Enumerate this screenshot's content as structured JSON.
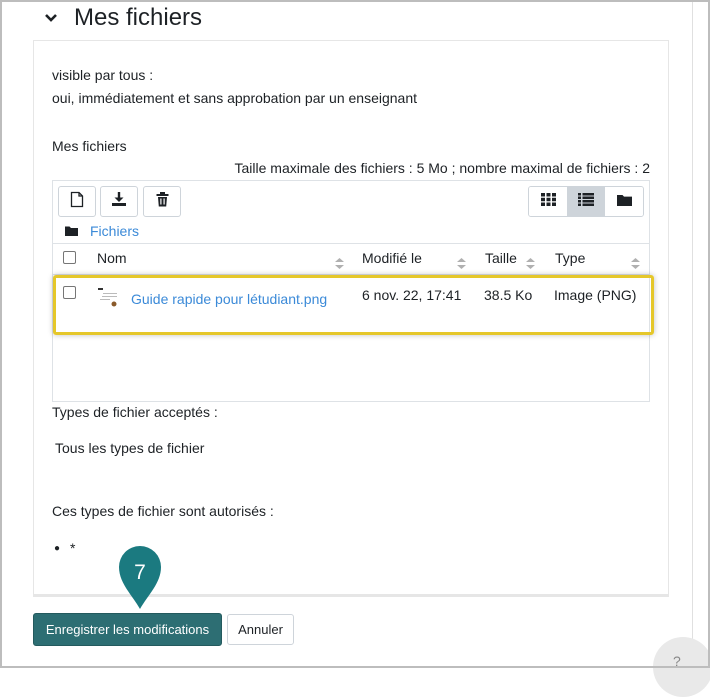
{
  "section": {
    "title": "Mes fichiers",
    "collapse_icon": "chevron-down-icon"
  },
  "visibility": {
    "label": "visible par tous :",
    "value": "oui, immédiatement et sans approbation par un enseignant"
  },
  "filepicker": {
    "label": "Mes fichiers",
    "limits": "Taille maximale des fichiers : 5 Mo ; nombre maximal de fichiers : 2",
    "toolbar": [
      "add-file-icon",
      "download-icon",
      "trash-icon"
    ],
    "views": [
      "grid-view-icon",
      "list-view-icon",
      "folder-view-icon"
    ],
    "active_view": "list",
    "path": "Fichiers",
    "columns": {
      "name": "Nom",
      "modified": "Modifié le",
      "size": "Taille",
      "type": "Type"
    },
    "files": [
      {
        "name": "Guide rapide pour létudiant.png",
        "modified": "6 nov. 22, 17:41",
        "size": "38.5 Ko",
        "type": "Image (PNG)"
      }
    ]
  },
  "accepted": {
    "label": "Types de fichier acceptés :",
    "value": "Tous les types de fichier",
    "allowed_label": "Ces types de fichier sont autorisés :",
    "allowed_items": [
      "*"
    ]
  },
  "actions": {
    "save": "Enregistrer les modifications",
    "cancel": "Annuler"
  },
  "marker": {
    "number": "7",
    "color": "#1b7a80"
  },
  "colors": {
    "accent_link": "#3b8ad8",
    "save_button": "#2d6e73",
    "highlight": "#e5c72a"
  }
}
